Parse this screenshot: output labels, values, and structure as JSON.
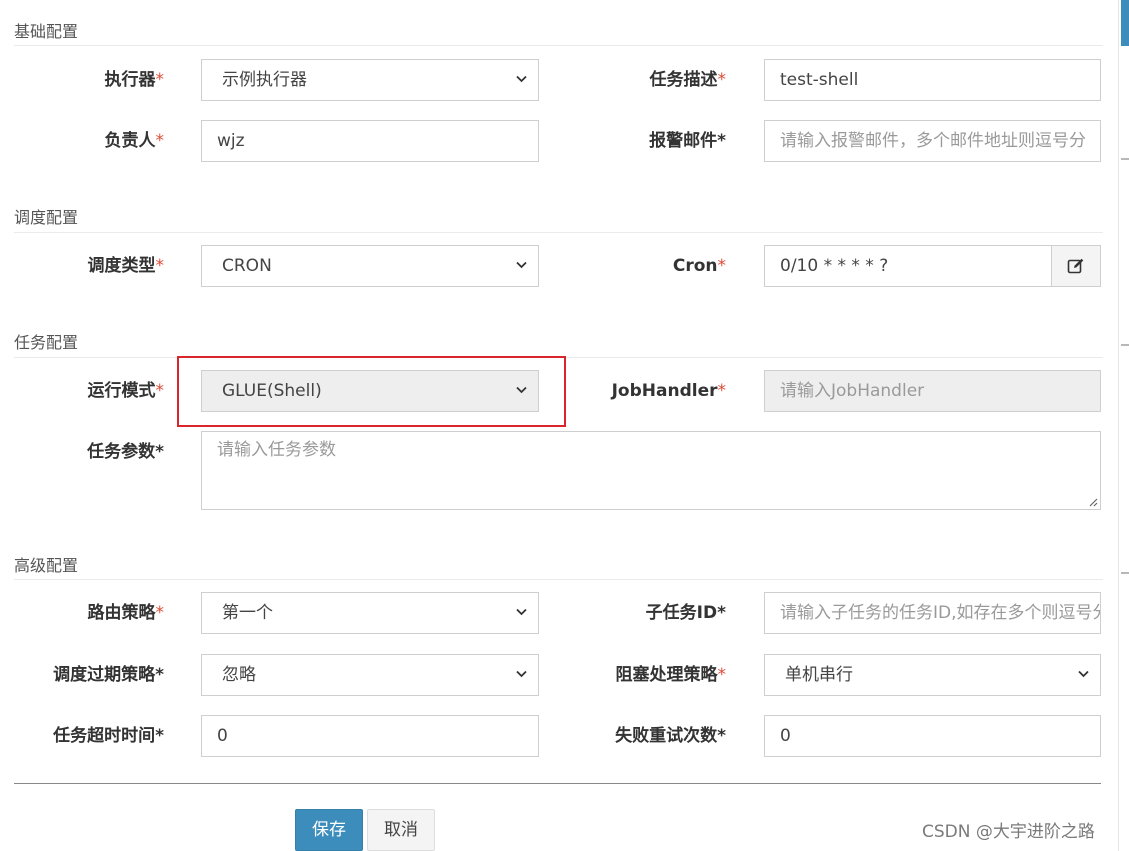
{
  "sections": {
    "basic": "基础配置",
    "schedule": "调度配置",
    "task": "任务配置",
    "advanced": "高级配置"
  },
  "required_mark": "*",
  "fields": {
    "executor": {
      "label": "执行器",
      "value": "示例执行器"
    },
    "job_desc": {
      "label": "任务描述",
      "value": "test-shell"
    },
    "author": {
      "label": "负责人",
      "value": "wjz"
    },
    "alarm_email": {
      "label": "报警邮件*",
      "placeholder": "请输入报警邮件，多个邮件地址则逗号分"
    },
    "schedule_type": {
      "label": "调度类型",
      "value": "CRON"
    },
    "cron": {
      "label": "Cron",
      "value": "0/10 * * * * ?",
      "addon_icon": "edit-icon"
    },
    "glue_type": {
      "label": "运行模式",
      "value": "GLUE(Shell)"
    },
    "job_handler": {
      "label": "JobHandler",
      "placeholder": "请输入JobHandler"
    },
    "job_param": {
      "label": "任务参数*",
      "placeholder": "请输入任务参数"
    },
    "route_strategy": {
      "label": "路由策略",
      "value": "第一个"
    },
    "child_job_id": {
      "label": "子任务ID*",
      "placeholder": "请输入子任务的任务ID,如存在多个则逗号分隔"
    },
    "misfire_strategy": {
      "label": "调度过期策略*",
      "value": "忽略"
    },
    "block_strategy": {
      "label": "阻塞处理策略",
      "value": "单机串行"
    },
    "timeout": {
      "label": "任务超时时间*",
      "value": "0"
    },
    "fail_retry": {
      "label": "失败重试次数*",
      "value": "0"
    }
  },
  "buttons": {
    "save": "保存",
    "cancel": "取消"
  },
  "watermark": "CSDN @大宇进阶之路",
  "colors": {
    "primary": "#3c8dbc",
    "required": "#dd4b39",
    "highlight": "#d9262c"
  }
}
